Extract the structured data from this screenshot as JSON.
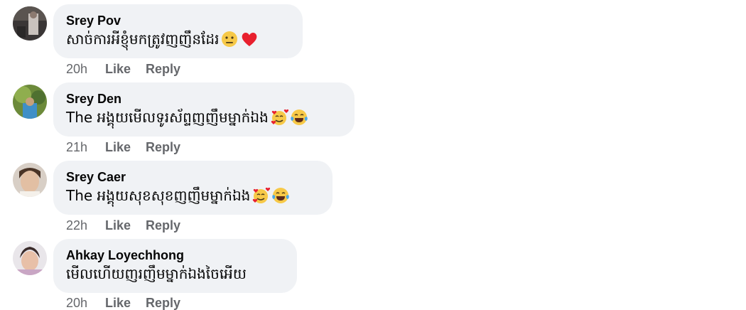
{
  "comments": [
    {
      "author": "Srey Pov",
      "text": "សាច់ការអីខ្ញុំមកត្រូវញញឹនដែរ",
      "emojis": [
        "neutral-face-emoji",
        "red-heart-emoji"
      ],
      "time": "20h",
      "like_label": "Like",
      "reply_label": "Reply"
    },
    {
      "author": "Srey Den",
      "text": "The អង្គុយមើលទូរស័ព្ទញញឹមម្នាក់ឯង",
      "emojis": [
        "smiling-face-with-hearts-emoji",
        "tears-of-joy-emoji"
      ],
      "time": "21h",
      "like_label": "Like",
      "reply_label": "Reply"
    },
    {
      "author": "Srey Caer",
      "text": "The អង្គុយសុខសុខញញឹមម្នាក់ឯង",
      "emojis": [
        "smiling-face-with-hearts-emoji",
        "tears-of-joy-emoji"
      ],
      "time": "22h",
      "like_label": "Like",
      "reply_label": "Reply"
    },
    {
      "author": "Ahkay Loyechhong",
      "text": "មើលហើយញរញឹមម្នាក់ឯងចៃអើយ",
      "emojis": [],
      "time": "20h",
      "like_label": "Like",
      "reply_label": "Reply"
    }
  ],
  "colors": {
    "bubble": "#f0f2f5",
    "text": "#050505",
    "meta": "#65676b"
  }
}
